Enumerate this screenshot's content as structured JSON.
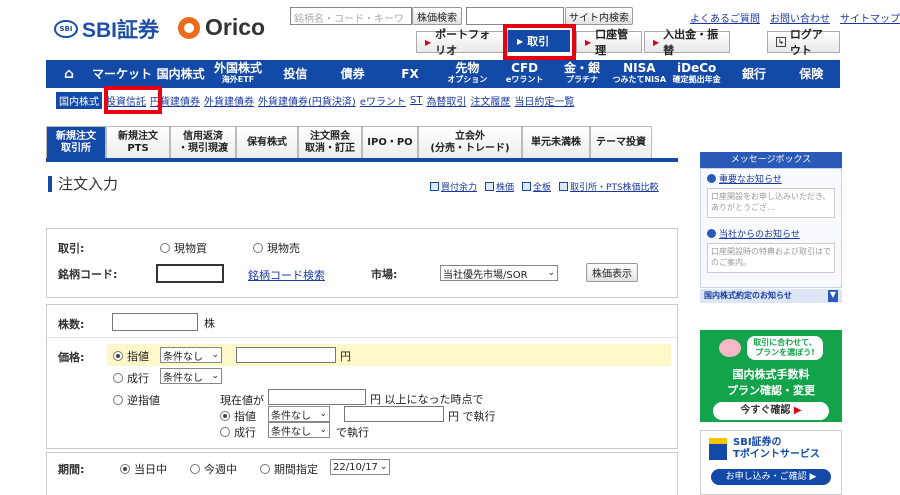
{
  "brand": {
    "sbi_mark": "SBI",
    "sbi": "SBI証券",
    "orico": "Orico"
  },
  "search": {
    "placeholder": "銘柄名・コード・キーワ",
    "stock_btn": "株価検索",
    "site_btn": "サイト内検索"
  },
  "top_links": [
    "よくあるご質問",
    "お問い合わせ",
    "サイトマップ"
  ],
  "account_tabs": [
    "ポートフォリオ",
    "取引",
    "口座管理",
    "入出金・振替"
  ],
  "logout": "ログアウト",
  "main_nav": [
    {
      "label": "マーケット",
      "sub": ""
    },
    {
      "label": "国内株式",
      "sub": ""
    },
    {
      "label": "外国株式",
      "sub": "海外ETF"
    },
    {
      "label": "投信",
      "sub": ""
    },
    {
      "label": "債券",
      "sub": ""
    },
    {
      "label": "FX",
      "sub": ""
    },
    {
      "label": "先物",
      "sub": "オプション"
    },
    {
      "label": "CFD",
      "sub": "eワラント"
    },
    {
      "label": "金・銀",
      "sub": "プラチナ"
    },
    {
      "label": "NISA",
      "sub": "つみたてNISA"
    },
    {
      "label": "iDeCo",
      "sub": "確定拠出年金"
    },
    {
      "label": "銀行",
      "sub": ""
    },
    {
      "label": "保険",
      "sub": ""
    }
  ],
  "sub_nav": [
    "国内株式",
    "投資信託",
    "円貨建債券",
    "外貨建債券",
    "外貨建債券(円貨決済)",
    "eワラント",
    "ST",
    "為替取引",
    "注文履歴",
    "当日約定一覧"
  ],
  "order_tabs": [
    {
      "l1": "新規注文",
      "l2": "取引所"
    },
    {
      "l1": "新規注文",
      "l2": "PTS"
    },
    {
      "l1": "信用返済",
      "l2": "・現引現渡"
    },
    {
      "l1": "保有株式",
      "l2": ""
    },
    {
      "l1": "注文照会",
      "l2": "取消・訂正"
    },
    {
      "l1": "IPO・PO",
      "l2": ""
    },
    {
      "l1": "立会外",
      "l2": "(分売・トレード)"
    },
    {
      "l1": "単元未満株",
      "l2": ""
    },
    {
      "l1": "テーマ投資",
      "l2": ""
    }
  ],
  "page_title": "注文入力",
  "tools": [
    "買付余力",
    "株価",
    "全板",
    "取引所・PTS株価比較"
  ],
  "form": {
    "trade_label": "取引:",
    "buy": "現物買",
    "sell": "現物売",
    "code_label": "銘柄コード:",
    "code_search": "銘柄コード検索",
    "market_label": "市場:",
    "market_value": "当社優先市場/SOR",
    "quote_btn": "株価表示",
    "qty_label": "株数:",
    "qty_unit": "株",
    "price_label": "価格:",
    "limit": "指値",
    "cond_none": "条件なし",
    "yen": "円",
    "market_order": "成行",
    "stop": "逆指値",
    "stop_text1": "現在値が",
    "stop_text2": "円 以上になった時点で",
    "stop_limit": "指値",
    "stop_exec": "円 で執行",
    "stop_market": "成行",
    "stop_exec2": "で執行",
    "period_label": "期間:",
    "today": "当日中",
    "this_week": "今週中",
    "period_spec": "期間指定",
    "period_date": "22/10/17"
  },
  "side": {
    "header": "メッセージボックス",
    "important": "重要なお知らせ",
    "msg1": "口座開設をお申し込みいただき、ありがとうござ…",
    "from_company": "当社からのお知らせ",
    "msg2": "口座開設時の特典および取引はでのご案内。",
    "contract": "国内株式約定のお知らせ",
    "green_t1": "取引に合わせて、",
    "green_t2": "プランを選ぼう!",
    "green_main1": "国内株式手数料",
    "green_main2": "プラン確認・変更",
    "green_btn": "今すぐ確認",
    "tp_title1": "SBI証券の",
    "tp_title2": "Tポイントサービス",
    "tp_btn": "お申し込み・ご確認"
  }
}
